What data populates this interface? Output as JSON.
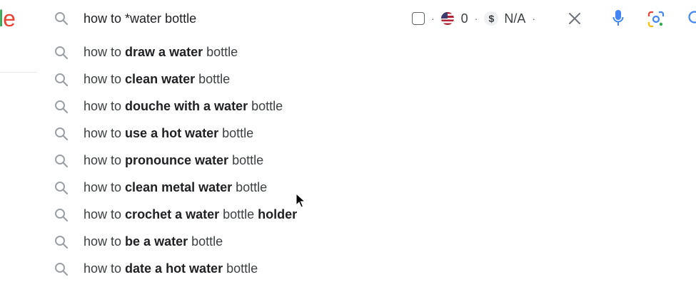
{
  "logo": {
    "fragment_l": "l",
    "fragment_e": "e"
  },
  "search": {
    "query": "how to *water bottle",
    "extension": {
      "count": "0",
      "cpc": "N/A",
      "separator": "·"
    }
  },
  "suggestions": [
    {
      "prefix": "how to ",
      "segments": [
        {
          "text": "draw a water",
          "bold": true
        },
        {
          "text": " bottle",
          "bold": false
        }
      ]
    },
    {
      "prefix": "how to ",
      "segments": [
        {
          "text": "clean water",
          "bold": true
        },
        {
          "text": " bottle",
          "bold": false
        }
      ]
    },
    {
      "prefix": "how to ",
      "segments": [
        {
          "text": "douche with a water",
          "bold": true
        },
        {
          "text": " bottle",
          "bold": false
        }
      ]
    },
    {
      "prefix": "how to ",
      "segments": [
        {
          "text": "use a hot water",
          "bold": true
        },
        {
          "text": " bottle",
          "bold": false
        }
      ]
    },
    {
      "prefix": "how to ",
      "segments": [
        {
          "text": "pronounce water",
          "bold": true
        },
        {
          "text": " bottle",
          "bold": false
        }
      ]
    },
    {
      "prefix": "how to ",
      "segments": [
        {
          "text": "clean metal water",
          "bold": true
        },
        {
          "text": " bottle",
          "bold": false
        }
      ]
    },
    {
      "prefix": "how to ",
      "segments": [
        {
          "text": "crochet a water",
          "bold": true
        },
        {
          "text": " bottle ",
          "bold": false
        },
        {
          "text": "holder",
          "bold": true
        }
      ]
    },
    {
      "prefix": "how to ",
      "segments": [
        {
          "text": "be a water",
          "bold": true
        },
        {
          "text": " bottle",
          "bold": false
        }
      ]
    },
    {
      "prefix": "how to ",
      "segments": [
        {
          "text": "date a hot water",
          "bold": true
        },
        {
          "text": " bottle",
          "bold": false
        }
      ]
    }
  ],
  "colors": {
    "mic_blue": "#4285f4",
    "text": "#202124",
    "icon_gray": "#9aa0a6"
  },
  "icons": [
    "search-icon",
    "checkbox-icon",
    "us-flag-icon",
    "dollar-icon",
    "clear-icon",
    "microphone-icon",
    "google-lens-icon",
    "search-submit-icon",
    "mouse-cursor-icon"
  ]
}
